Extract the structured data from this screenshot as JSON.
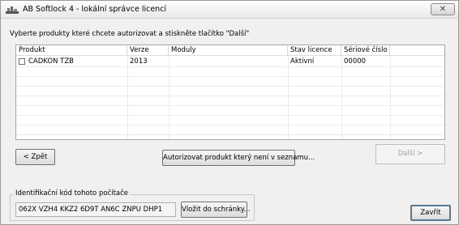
{
  "window": {
    "title": "AB Softlock 4  -  lokální správce licencí",
    "close_glyph": "✕"
  },
  "instruction": "Vyberte produkty které chcete autorizovat a stiskněte tlačítko \"Další\"",
  "table": {
    "columns": [
      "Produkt",
      "Verze",
      "Moduly",
      "Stav licence",
      "Sériové číslo"
    ],
    "rows": [
      {
        "checked": false,
        "produkt": "CADKON TZB",
        "verze": "2013",
        "moduly": "",
        "stav": "Aktivní",
        "seriove": "00000"
      }
    ]
  },
  "buttons": {
    "back": "< Zpět",
    "authorize": "Autorizovat produkt který není v seznamu...",
    "next": "Další >",
    "copy": "Vložit do schránky...",
    "close": "Zavřít"
  },
  "identification": {
    "legend": "Identifikační kód tohoto počítače",
    "code": "062X VZH4 KKZ2 6D9T AN6C ZNPU DHP1"
  }
}
